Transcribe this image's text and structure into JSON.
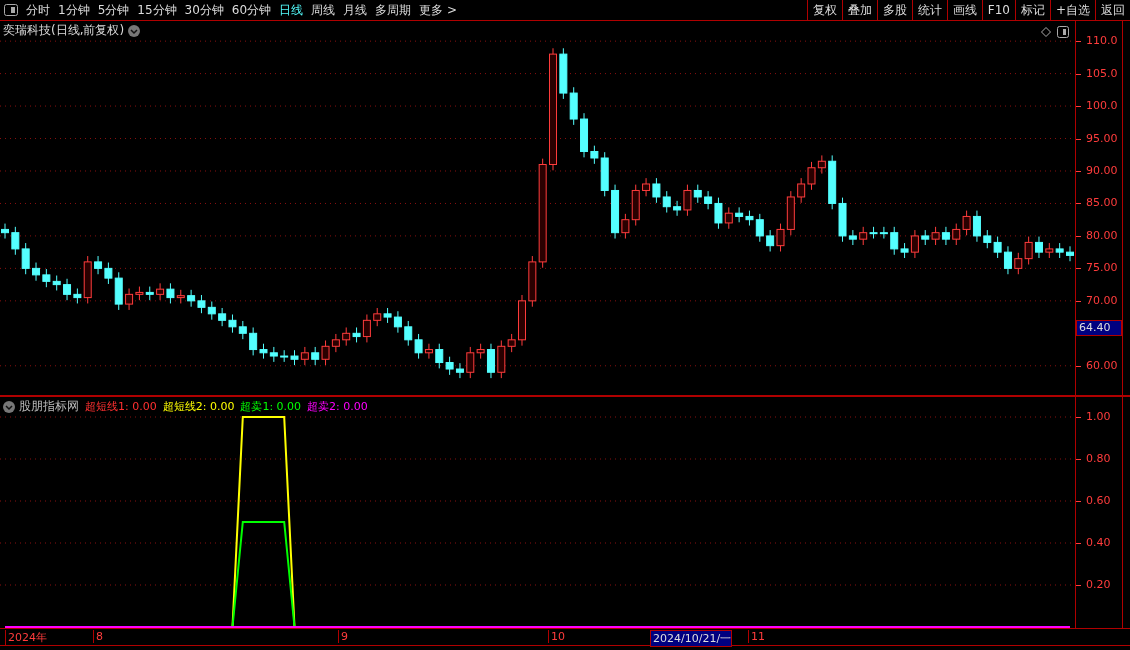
{
  "toolbar": {
    "periods": [
      {
        "label": "分时",
        "selected": false
      },
      {
        "label": "1分钟",
        "selected": false
      },
      {
        "label": "5分钟",
        "selected": false
      },
      {
        "label": "15分钟",
        "selected": false
      },
      {
        "label": "30分钟",
        "selected": false
      },
      {
        "label": "60分钟",
        "selected": false
      },
      {
        "label": "日线",
        "selected": true
      },
      {
        "label": "周线",
        "selected": false
      },
      {
        "label": "月线",
        "selected": false
      },
      {
        "label": "多周期",
        "selected": false
      },
      {
        "label": "更多 >",
        "selected": false
      }
    ],
    "buttons": [
      "复权",
      "叠加",
      "多股",
      "统计",
      "画线",
      "F10",
      "标记",
      "+自选",
      "返回"
    ]
  },
  "main_chart": {
    "title": "奕瑞科技(日线,前复权)",
    "current_price": "64.40",
    "chart_data": {
      "type": "candlestick",
      "ylim": [
        55.5,
        113.1
      ],
      "grid": true,
      "categories": [
        null,
        null,
        null,
        null,
        null,
        null,
        null,
        null,
        null,
        null,
        null,
        null,
        null,
        null,
        null,
        null,
        null,
        null,
        null,
        null,
        null,
        null,
        null,
        null,
        null,
        null,
        null,
        null,
        null,
        null,
        null,
        null,
        null,
        null,
        null,
        null,
        null,
        null,
        null,
        null,
        null,
        null,
        null,
        null,
        null,
        null,
        null,
        null,
        null,
        null,
        null,
        null,
        null,
        null,
        null,
        null,
        null,
        null,
        null,
        null,
        null,
        null,
        null,
        null,
        null,
        null,
        null,
        null,
        null,
        null,
        null,
        null,
        null,
        null,
        null,
        null,
        null,
        null,
        null,
        null,
        null,
        null,
        null,
        null,
        null,
        null,
        null,
        null,
        null,
        null,
        null,
        null,
        null,
        null,
        null,
        null,
        null,
        null,
        null,
        null,
        null,
        null,
        null,
        null
      ],
      "yticks": [
        {
          "value": 110,
          "label": "110.0"
        },
        {
          "value": 105,
          "label": "105.0"
        },
        {
          "value": 100,
          "label": "100.0"
        },
        {
          "value": 95,
          "label": "95.00"
        },
        {
          "value": 90,
          "label": "90.00"
        },
        {
          "value": 85,
          "label": "85.00"
        },
        {
          "value": 80,
          "label": "80.00"
        },
        {
          "value": 75,
          "label": "75.00"
        },
        {
          "value": 70,
          "label": "70.00"
        },
        {
          "value": 60,
          "label": "60.00"
        }
      ],
      "ohlc": [
        [
          81,
          81.9,
          79.6,
          80.5
        ],
        [
          80.5,
          81.4,
          77.1,
          78
        ],
        [
          78,
          78.9,
          74.1,
          75
        ],
        [
          75,
          75.9,
          73.1,
          74
        ],
        [
          74,
          74.9,
          72.1,
          73
        ],
        [
          73,
          73.9,
          71.6,
          72.5
        ],
        [
          72.5,
          73.4,
          70.1,
          71
        ],
        [
          71,
          71.9,
          69.6,
          70.5
        ],
        [
          70.5,
          76.9,
          69.6,
          76
        ],
        [
          76,
          76.9,
          74.1,
          75
        ],
        [
          75,
          75.9,
          72.6,
          73.5
        ],
        [
          73.5,
          74.4,
          68.6,
          69.5
        ],
        [
          69.5,
          71.9,
          68.6,
          71
        ],
        [
          71,
          72.2,
          70.1,
          71.3
        ],
        [
          71.3,
          72.2,
          70.1,
          71
        ],
        [
          71,
          72.7,
          70.1,
          71.8
        ],
        [
          71.8,
          72.7,
          69.6,
          70.5
        ],
        [
          70.5,
          71.7,
          69.6,
          70.8
        ],
        [
          70.8,
          71.7,
          69.1,
          70
        ],
        [
          70,
          70.9,
          68.1,
          69
        ],
        [
          69,
          69.9,
          67.1,
          68
        ],
        [
          68,
          68.9,
          66.1,
          67
        ],
        [
          67,
          67.9,
          65.1,
          66
        ],
        [
          66,
          66.9,
          64.1,
          65
        ],
        [
          65,
          65.9,
          61.6,
          62.5
        ],
        [
          62.5,
          63.4,
          61.1,
          62
        ],
        [
          62,
          62.9,
          60.6,
          61.5
        ],
        [
          61.5,
          62.4,
          60.6,
          61.5
        ],
        [
          61.5,
          62.4,
          60.1,
          61
        ],
        [
          61,
          62.9,
          60.1,
          62
        ],
        [
          62,
          62.9,
          60.1,
          61
        ],
        [
          61,
          63.9,
          60.1,
          63
        ],
        [
          63,
          64.9,
          62.1,
          64
        ],
        [
          64,
          65.9,
          63.1,
          65
        ],
        [
          65,
          65.9,
          63.6,
          64.5
        ],
        [
          64.5,
          67.9,
          63.6,
          67
        ],
        [
          67,
          68.9,
          66.1,
          68
        ],
        [
          68,
          68.9,
          66.6,
          67.5
        ],
        [
          67.5,
          68.4,
          65.1,
          66
        ],
        [
          66,
          66.9,
          63.1,
          64
        ],
        [
          64,
          64.9,
          61.1,
          62
        ],
        [
          62,
          63.4,
          61.1,
          62.5
        ],
        [
          62.5,
          63.4,
          59.6,
          60.5
        ],
        [
          60.5,
          61.4,
          58.6,
          59.5
        ],
        [
          59.5,
          60.4,
          58.1,
          59
        ],
        [
          59,
          62.9,
          58.1,
          62
        ],
        [
          62,
          63.4,
          61.1,
          62.5
        ],
        [
          62.5,
          63.4,
          58.1,
          59
        ],
        [
          59,
          63.9,
          58.1,
          63
        ],
        [
          63,
          64.9,
          62.1,
          64
        ],
        [
          64,
          70.9,
          63.1,
          70
        ],
        [
          70,
          76.9,
          69.1,
          76
        ],
        [
          76,
          91.9,
          75.1,
          91
        ],
        [
          91,
          108.9,
          90.1,
          108
        ],
        [
          108,
          108.9,
          101.1,
          102
        ],
        [
          102,
          102.9,
          97.1,
          98
        ],
        [
          98,
          98.9,
          92.1,
          93
        ],
        [
          93,
          93.9,
          91.1,
          92
        ],
        [
          92,
          92.9,
          86.1,
          87
        ],
        [
          87,
          87.9,
          79.6,
          80.5
        ],
        [
          80.5,
          83.4,
          79.6,
          82.5
        ],
        [
          82.5,
          87.9,
          81.6,
          87
        ],
        [
          87,
          88.9,
          86.1,
          88
        ],
        [
          88,
          88.9,
          85.1,
          86
        ],
        [
          86,
          86.9,
          83.6,
          84.5
        ],
        [
          84.5,
          85.4,
          83.1,
          84
        ],
        [
          84,
          87.9,
          83.1,
          87
        ],
        [
          87,
          87.9,
          85.1,
          86
        ],
        [
          86,
          86.9,
          84.1,
          85
        ],
        [
          85,
          85.9,
          81.1,
          82
        ],
        [
          82,
          84.4,
          81.1,
          83.5
        ],
        [
          83.5,
          84.4,
          82.1,
          83
        ],
        [
          83,
          83.9,
          81.6,
          82.5
        ],
        [
          82.5,
          83.4,
          79.1,
          80
        ],
        [
          80,
          80.9,
          77.6,
          78.5
        ],
        [
          78.5,
          81.9,
          77.6,
          81
        ],
        [
          81,
          86.9,
          80.1,
          86
        ],
        [
          86,
          88.9,
          85.1,
          88
        ],
        [
          88,
          91.4,
          87.1,
          90.5
        ],
        [
          90.5,
          92.4,
          89.6,
          91.5
        ],
        [
          91.5,
          92.4,
          84.1,
          85
        ],
        [
          85,
          85.9,
          79.1,
          80
        ],
        [
          80,
          80.9,
          78.6,
          79.5
        ],
        [
          79.5,
          81.4,
          78.6,
          80.5
        ],
        [
          80.5,
          81.4,
          79.6,
          80.5
        ],
        [
          80.5,
          81.4,
          79.6,
          80.5
        ],
        [
          80.5,
          81.4,
          77.1,
          78
        ],
        [
          78,
          78.9,
          76.6,
          77.5
        ],
        [
          77.5,
          80.9,
          76.6,
          80
        ],
        [
          80,
          80.9,
          78.6,
          79.5
        ],
        [
          79.5,
          81.4,
          78.6,
          80.5
        ],
        [
          80.5,
          81.4,
          78.6,
          79.5
        ],
        [
          79.5,
          81.9,
          78.6,
          81
        ],
        [
          81,
          83.9,
          80.1,
          83
        ],
        [
          83,
          83.9,
          79.1,
          80
        ],
        [
          80,
          80.9,
          78.1,
          79
        ],
        [
          79,
          79.9,
          76.6,
          77.5
        ],
        [
          77.5,
          78.4,
          74.1,
          75
        ],
        [
          75,
          77.4,
          74.1,
          76.5
        ],
        [
          76.5,
          79.9,
          75.6,
          79
        ],
        [
          79,
          79.9,
          76.6,
          77.5
        ],
        [
          77.5,
          78.9,
          76.6,
          78
        ],
        [
          78,
          78.9,
          76.6,
          77.5
        ],
        [
          77.5,
          78.4,
          76.1,
          77
        ]
      ]
    }
  },
  "indicator": {
    "name": "股朋指标网",
    "legend_values": [
      ": 0.00",
      ": 0.00",
      ": 0.00",
      ": 0.00"
    ],
    "chart_data": {
      "type": "line",
      "ylim": [
        0,
        1.1
      ],
      "grid": true,
      "categories": [
        null,
        null,
        null,
        null,
        null,
        null,
        null,
        null,
        null,
        null,
        null,
        null,
        null,
        null,
        null,
        null,
        null,
        null,
        null,
        null,
        null,
        null,
        null,
        null,
        null,
        null,
        null,
        null,
        null,
        null,
        null,
        null,
        null,
        null,
        null,
        null,
        null,
        null,
        null,
        null,
        null,
        null,
        null,
        null,
        null,
        null,
        null,
        null,
        null,
        null,
        null,
        null,
        null,
        null,
        null,
        null,
        null,
        null,
        null,
        null,
        null,
        null,
        null,
        null,
        null,
        null,
        null,
        null,
        null,
        null,
        null,
        null,
        null,
        null,
        null,
        null,
        null,
        null,
        null,
        null,
        null,
        null,
        null,
        null,
        null,
        null,
        null,
        null,
        null,
        null,
        null,
        null,
        null,
        null,
        null,
        null,
        null,
        null,
        null,
        null,
        null,
        null,
        null,
        null
      ],
      "yticks": [
        {
          "value": 1,
          "label": "1.00"
        },
        {
          "value": 0.8,
          "label": "0.80"
        },
        {
          "value": 0.6,
          "label": "0.60"
        },
        {
          "value": 0.4,
          "label": "0.40"
        },
        {
          "value": 0.2,
          "label": "0.20"
        }
      ],
      "series": [
        {
          "name": "超短线1",
          "color": "#ff3030",
          "values": [
            null,
            null,
            null,
            null,
            null,
            null,
            null,
            null,
            null,
            null,
            null,
            null,
            null,
            null,
            null,
            null,
            null,
            null,
            null,
            null,
            null,
            null,
            null,
            null,
            null,
            null,
            null,
            null,
            null,
            null,
            null,
            null,
            null,
            null,
            null,
            null,
            null,
            null,
            null,
            null,
            null,
            null,
            null,
            null,
            null,
            null,
            null,
            null,
            null,
            null,
            null,
            null,
            null,
            null,
            null,
            null,
            null,
            null,
            null,
            null,
            null,
            null,
            null,
            null,
            null,
            null,
            null,
            null,
            null,
            null,
            null,
            null,
            null,
            null,
            null,
            null,
            null,
            null,
            null,
            null,
            null,
            null,
            null,
            null,
            null,
            null,
            null,
            null,
            null,
            null,
            null,
            null,
            null,
            null,
            null,
            null,
            null,
            null,
            null,
            null,
            null,
            null,
            null,
            null
          ]
        },
        {
          "name": "超短线2",
          "color": "#ffff00",
          "values": [
            null,
            null,
            null,
            null,
            null,
            null,
            null,
            null,
            null,
            null,
            null,
            null,
            null,
            null,
            null,
            null,
            null,
            null,
            null,
            null,
            null,
            null,
            0,
            1,
            1,
            1,
            1,
            1,
            0,
            null,
            null,
            null,
            null,
            null,
            null,
            null,
            null,
            null,
            null,
            null,
            null,
            null,
            null,
            null,
            null,
            null,
            null,
            null,
            null,
            null,
            null,
            null,
            null,
            null,
            null,
            null,
            null,
            null,
            null,
            null,
            null,
            null,
            null,
            null,
            null,
            null,
            null,
            null,
            null,
            null,
            null,
            null,
            null,
            null,
            null,
            null,
            null,
            null,
            null,
            null,
            null,
            null,
            null,
            null,
            null,
            null,
            null,
            null,
            null,
            null,
            null,
            null,
            null,
            null,
            null,
            null,
            null,
            null,
            null,
            null,
            null,
            null,
            null,
            null
          ]
        },
        {
          "name": "超卖1",
          "color": "#00ff00",
          "values": [
            null,
            null,
            null,
            null,
            null,
            null,
            null,
            null,
            null,
            null,
            null,
            null,
            null,
            null,
            null,
            null,
            null,
            null,
            null,
            null,
            null,
            null,
            0,
            0.5,
            0.5,
            0.5,
            0.5,
            0.5,
            0,
            null,
            null,
            null,
            null,
            null,
            null,
            null,
            null,
            null,
            null,
            null,
            null,
            null,
            null,
            null,
            null,
            null,
            null,
            null,
            null,
            null,
            null,
            null,
            null,
            null,
            null,
            null,
            null,
            null,
            null,
            null,
            null,
            null,
            null,
            null,
            null,
            null,
            null,
            null,
            null,
            null,
            null,
            null,
            null,
            null,
            null,
            null,
            null,
            null,
            null,
            null,
            null,
            null,
            null,
            null,
            null,
            null,
            null,
            null,
            null,
            null,
            null,
            null,
            null,
            null,
            null,
            null,
            null,
            null,
            null,
            null,
            null,
            null,
            null,
            null
          ]
        },
        {
          "name": "超卖2",
          "color": "#ff00ff",
          "values": [
            0,
            0,
            0,
            0,
            0,
            0,
            0,
            0,
            0,
            0,
            0,
            0,
            0,
            0,
            0,
            0,
            0,
            0,
            0,
            0,
            0,
            0,
            0,
            0,
            0,
            0,
            0,
            0,
            0,
            0,
            0,
            0,
            0,
            0,
            0,
            0,
            0,
            0,
            0,
            0,
            0,
            0,
            0,
            0,
            0,
            0,
            0,
            0,
            0,
            0,
            0,
            0,
            0,
            0,
            0,
            0,
            0,
            0,
            0,
            0,
            0,
            0,
            0,
            0,
            0,
            0,
            0,
            0,
            0,
            0,
            0,
            0,
            0,
            0,
            0,
            0,
            0,
            0,
            0,
            0,
            0,
            0,
            0,
            0,
            0,
            0,
            0,
            0,
            0,
            0,
            0,
            0,
            0,
            0,
            0,
            0,
            0,
            0,
            0,
            0,
            0,
            0,
            0,
            0
          ]
        }
      ]
    }
  },
  "date_axis": [
    {
      "label": "2024年",
      "kind": "month"
    },
    {
      "label": "8",
      "kind": "month"
    },
    {
      "label": "9",
      "kind": "month"
    },
    {
      "label": "10",
      "kind": "month"
    },
    {
      "label": "2024/10/21/一",
      "kind": "cursor"
    },
    {
      "label": "11",
      "kind": "month"
    }
  ]
}
